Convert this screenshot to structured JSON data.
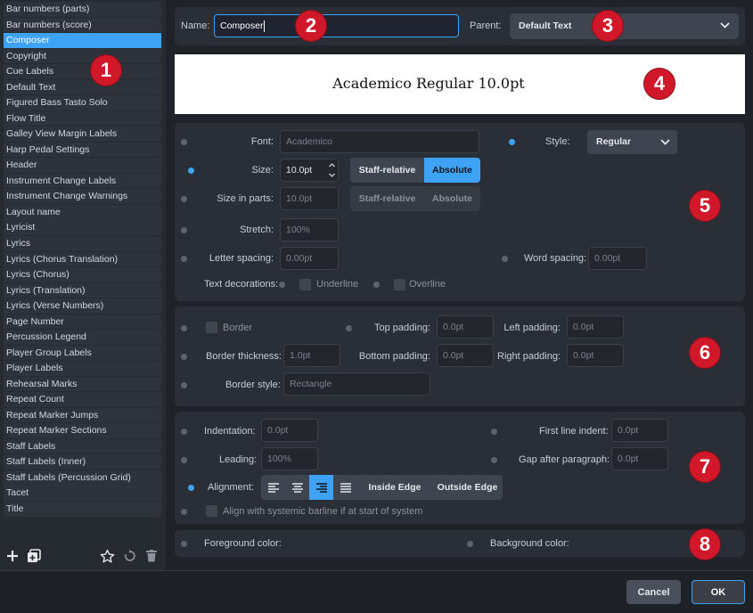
{
  "styles": [
    "Bar numbers (parts)",
    "Bar numbers (score)",
    "Composer",
    "Copyright",
    "Cue Labels",
    "Default Text",
    "Figured Bass Tasto Solo",
    "Flow Title",
    "Galley View Margin Labels",
    "Harp Pedal Settings",
    "Header",
    "Instrument Change Labels",
    "Instrument Change Warnings",
    "Layout name",
    "Lyricist",
    "Lyrics",
    "Lyrics (Chorus Translation)",
    "Lyrics (Chorus)",
    "Lyrics (Translation)",
    "Lyrics (Verse Numbers)",
    "Page Number",
    "Percussion Legend",
    "Player Group Labels",
    "Player Labels",
    "Rehearsal Marks",
    "Repeat Count",
    "Repeat Marker Jumps",
    "Repeat Marker Sections",
    "Staff Labels",
    "Staff Labels (Inner)",
    "Staff Labels (Percussion Grid)",
    "Tacet",
    "Title"
  ],
  "selected_index": 2,
  "header": {
    "name_label": "Name:",
    "name_value": "Composer",
    "parent_label": "Parent:",
    "parent_value": "Default Text"
  },
  "preview": {
    "text": "Academico Regular 10.0pt"
  },
  "font": {
    "font_label": "Font:",
    "font_value": "Academico",
    "style_label": "Style:",
    "style_value": "Regular",
    "size_label": "Size:",
    "size_value": "10.0pt",
    "staff_relative": "Staff-relative",
    "absolute": "Absolute",
    "size_parts_label": "Size in parts:",
    "size_parts_value": "10.0pt",
    "stretch_label": "Stretch:",
    "stretch_value": "100%",
    "letter_label": "Letter spacing:",
    "letter_value": "0.00pt",
    "word_label": "Word spacing:",
    "word_value": "0.00pt",
    "deco_label": "Text decorations:",
    "underline": "Underline",
    "overline": "Overline"
  },
  "border": {
    "border_label": "Border",
    "thickness_label": "Border thickness:",
    "thickness_value": "1.0pt",
    "style_label": "Border style:",
    "style_value": "Rectangle",
    "top_label": "Top padding:",
    "top_value": "0.0pt",
    "bottom_label": "Bottom padding:",
    "bottom_value": "0.0pt",
    "left_label": "Left padding:",
    "left_value": "0.0pt",
    "right_label": "Right padding:",
    "right_value": "0.0pt"
  },
  "paragraph": {
    "indent_label": "Indentation:",
    "indent_value": "0.0pt",
    "first_label": "First line indent:",
    "first_value": "0.0pt",
    "leading_label": "Leading:",
    "leading_value": "100%",
    "gap_label": "Gap after paragraph:",
    "gap_value": "0.0pt",
    "align_label": "Alignment:",
    "inside_edge": "Inside Edge",
    "outside_edge": "Outside Edge",
    "barline_label": "Align with systemic barline if at start of system"
  },
  "colors": {
    "fg_label": "Foreground color:",
    "bg_label": "Background color:",
    "accent": "#3ea2f5",
    "badge": "#d0182a"
  },
  "badges": [
    "1",
    "2",
    "3",
    "4",
    "5",
    "6",
    "7",
    "8"
  ],
  "buttons": {
    "cancel": "Cancel",
    "ok": "OK"
  },
  "icons": [
    "add-icon",
    "duplicate-icon",
    "star-icon",
    "reset-icon",
    "delete-icon",
    "chevron-down-icon"
  ]
}
